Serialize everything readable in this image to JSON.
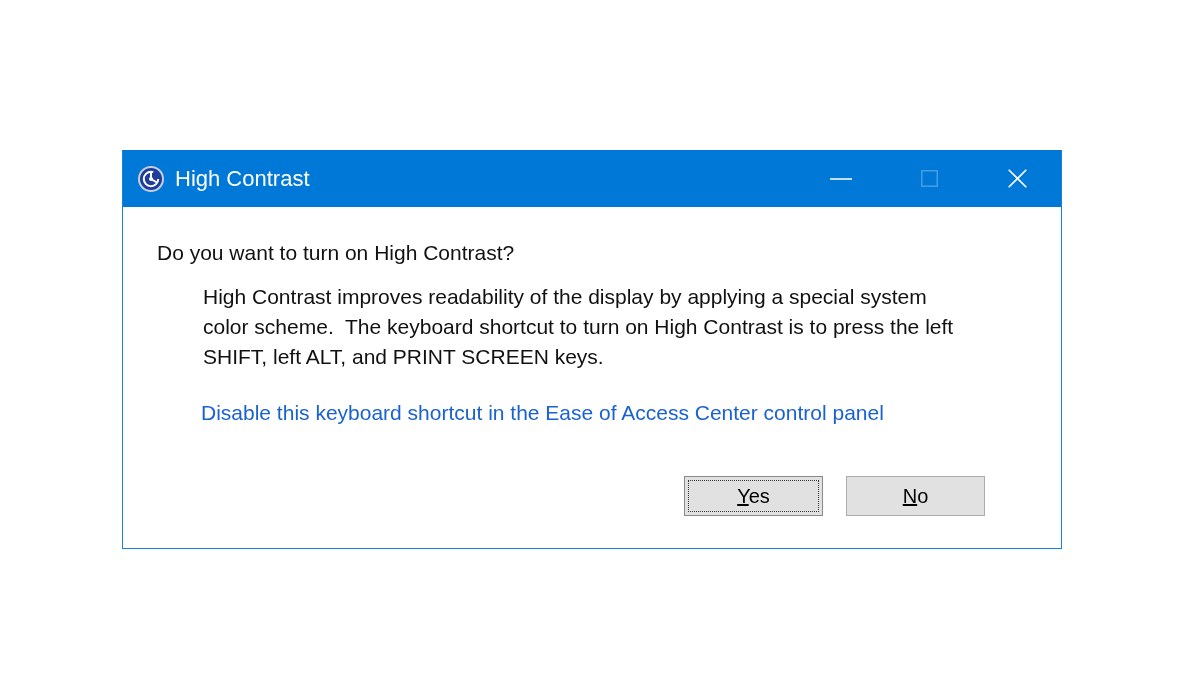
{
  "window": {
    "title": "High Contrast",
    "controls": [
      {
        "kind": "minimize",
        "disabled": false
      },
      {
        "kind": "maximize",
        "disabled": true
      },
      {
        "kind": "close",
        "disabled": false
      }
    ]
  },
  "question": "Do you want to turn on High Contrast?",
  "description": "High Contrast improves readability of the display by applying a special system color scheme.  The keyboard shortcut to turn on High Contrast is to press the left SHIFT, left ALT, and PRINT SCREEN keys.",
  "link": "Disable this keyboard shortcut in the Ease of Access Center control panel",
  "buttons": [
    {
      "label": "Yes",
      "focused": true
    },
    {
      "label": "No",
      "focused": false
    }
  ]
}
